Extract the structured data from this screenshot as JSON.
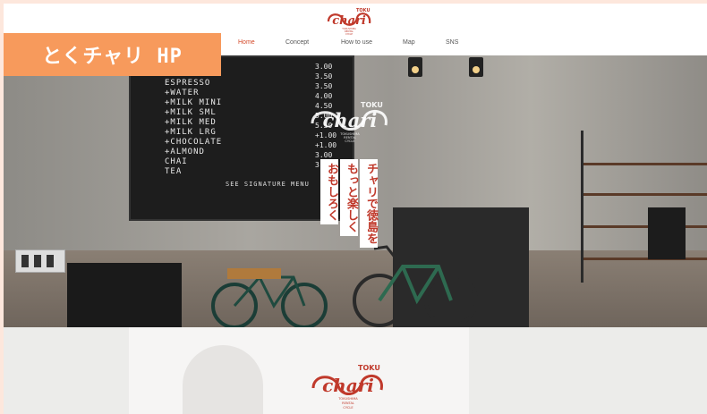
{
  "badge": {
    "label": "とくチャリ HP"
  },
  "logo": {
    "top_word": "TOKU",
    "main_word": "chari",
    "sub_lines": [
      "TOKUSHIMA",
      "RENTAL",
      "CYCLE"
    ]
  },
  "nav": {
    "items": [
      {
        "label": "Home",
        "active": true
      },
      {
        "label": "Concept",
        "active": false
      },
      {
        "label": "How to use",
        "active": false
      },
      {
        "label": "Map",
        "active": false
      },
      {
        "label": "SNS",
        "active": false
      }
    ]
  },
  "menu_board": {
    "items": [
      "ESPRESSO",
      "+WATER",
      "+MILK MINI",
      "+MILK SML",
      "+MILK MED",
      "+MILK LRG",
      "+CHOCOLATE",
      "+ALMOND",
      "CHAI",
      "TEA"
    ],
    "prices": [
      "3.00",
      "3.50",
      "3.50",
      "4.00",
      "4.50",
      "5.00",
      "5.50",
      "+1.00",
      "+1.00",
      "3.00",
      "3.00"
    ],
    "footer": "SEE SIGNATURE MENU"
  },
  "tagline": {
    "columns": [
      "チャリで徳島を",
      "もっと楽しく",
      "おもしろく"
    ]
  },
  "colors": {
    "accent": "#c0392b",
    "badge": "#f79a5c",
    "nav_active": "#d44a2a",
    "page_bg": "#fde7dc"
  }
}
